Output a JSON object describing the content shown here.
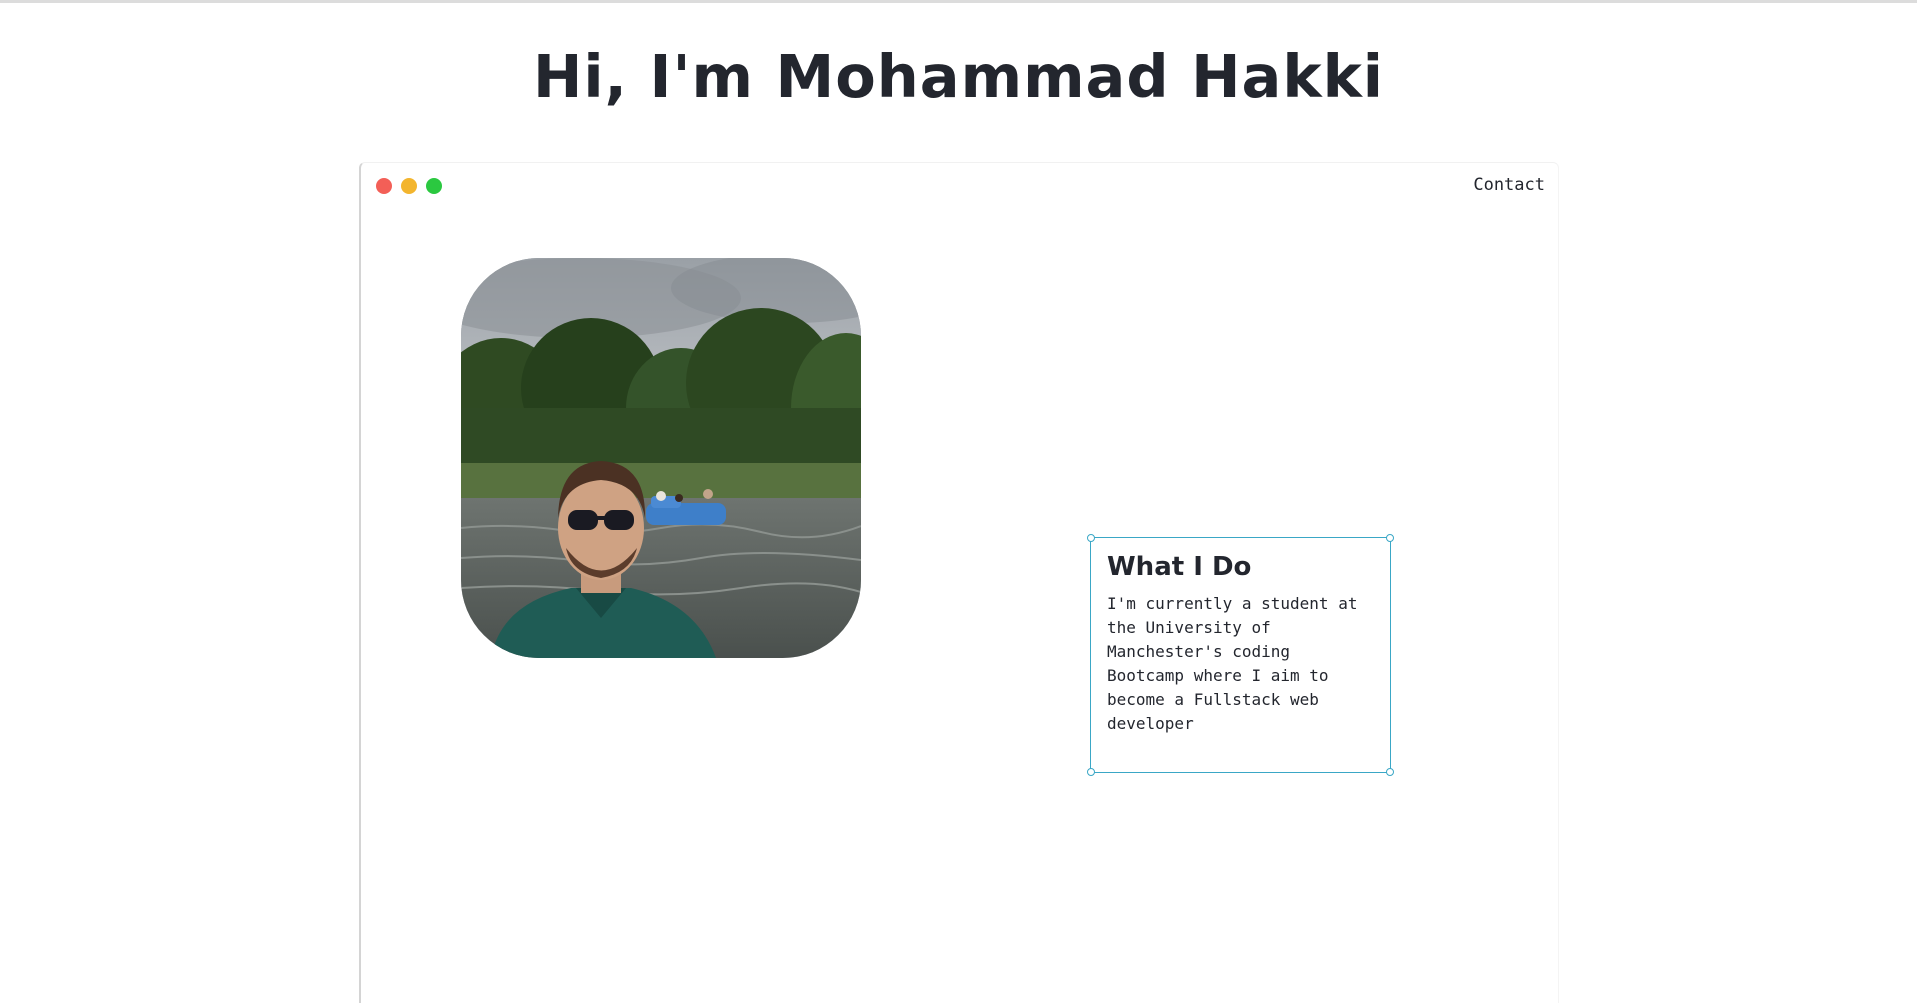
{
  "header": {
    "title": "Hi, I'm Mohammad Hakki"
  },
  "window": {
    "controls": [
      "close",
      "minimize",
      "maximize"
    ],
    "colors": {
      "close": "#f35f57",
      "minimize": "#f3b52e",
      "maximize": "#2bc840"
    },
    "nav": {
      "contact_label": "Contact"
    }
  },
  "profile": {
    "photo_subject": "man with sunglasses in green polo shirt in front of a lake with a blue pedal boat and trees"
  },
  "about": {
    "heading": "What I Do",
    "body": "I'm currently a student at the University of Manchester's coding Bootcamp where I aim to become a Fullstack web developer"
  },
  "colors": {
    "text": "#23262e",
    "selection_outline": "#3aa7c6"
  }
}
